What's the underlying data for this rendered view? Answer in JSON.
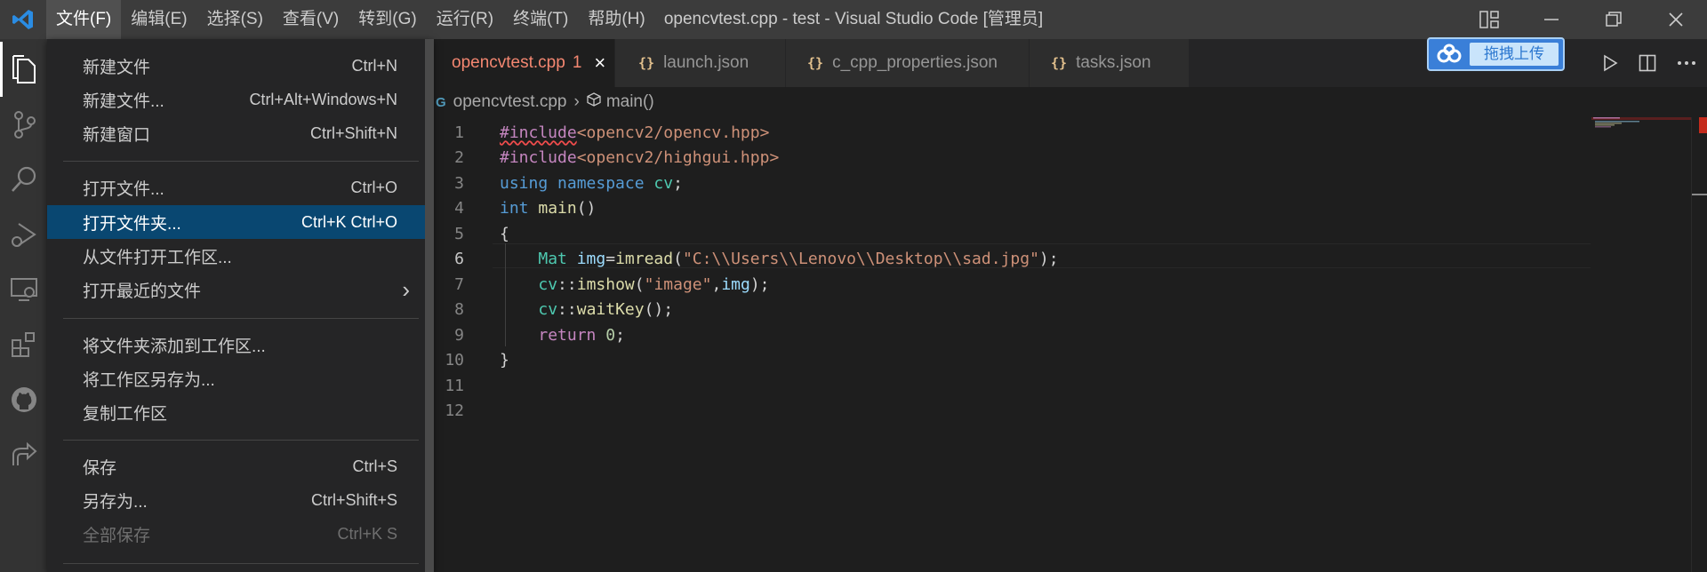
{
  "window": {
    "title": "opencvtest.cpp - test - Visual Studio Code [管理员]"
  },
  "menubar": {
    "items": [
      "文件(F)",
      "编辑(E)",
      "选择(S)",
      "查看(V)",
      "转到(G)",
      "运行(R)",
      "终端(T)",
      "帮助(H)"
    ]
  },
  "file_menu": {
    "items": [
      {
        "label": "新建文件",
        "accel": "Ctrl+N"
      },
      {
        "label": "新建文件...",
        "accel": "Ctrl+Alt+Windows+N"
      },
      {
        "label": "新建窗口",
        "accel": "Ctrl+Shift+N"
      },
      {
        "label": "打开文件...",
        "accel": "Ctrl+O"
      },
      {
        "label": "打开文件夹...",
        "accel": "Ctrl+K Ctrl+O"
      },
      {
        "label": "从文件打开工作区...",
        "accel": ""
      },
      {
        "label": "打开最近的文件",
        "accel": "›"
      },
      {
        "label": "将文件夹添加到工作区...",
        "accel": ""
      },
      {
        "label": "将工作区另存为...",
        "accel": ""
      },
      {
        "label": "复制工作区",
        "accel": ""
      },
      {
        "label": "保存",
        "accel": "Ctrl+S"
      },
      {
        "label": "另存为...",
        "accel": "Ctrl+Shift+S"
      },
      {
        "label": "全部保存",
        "accel": "Ctrl+K S"
      }
    ]
  },
  "tabs": [
    {
      "label": "opencvtest.cpp",
      "badge": "1",
      "close": "×"
    },
    {
      "label": "launch.json",
      "icon": "{}"
    },
    {
      "label": "c_cpp_properties.json",
      "icon": "{}"
    },
    {
      "label": "tasks.json",
      "icon": "{}"
    }
  ],
  "upload_button": {
    "label": "拖拽上传"
  },
  "breadcrumb": {
    "file": "opencvtest.cpp",
    "symbol": "main()"
  },
  "editor": {
    "line_numbers": [
      "1",
      "2",
      "3",
      "4",
      "5",
      "6",
      "7",
      "8",
      "9",
      "10",
      "11",
      "12"
    ],
    "lines": {
      "l1": {
        "a": "#include",
        "b": "<opencv2/opencv.hpp>"
      },
      "l2": {
        "a": "#include",
        "b": "<opencv2/highgui.hpp>"
      },
      "l3": {
        "a": "using",
        "b": " namespace",
        "c": " cv",
        "d": ";"
      },
      "l4": {
        "a": "int",
        "b": " main",
        "c": "()"
      },
      "l5": {
        "a": "{"
      },
      "l6": {
        "a": "Mat",
        "b": " img",
        "c": "=",
        "d": "imread",
        "e": "(",
        "f": "\"C:\\\\Users\\\\Lenovo\\\\Desktop\\\\sad.jpg\"",
        "g": ");"
      },
      "l7": {
        "a": "cv",
        "b": "::",
        "c": "imshow",
        "d": "(",
        "e": "\"image\"",
        "f": ",",
        "g": "img",
        "h": ");"
      },
      "l8": {
        "a": "cv",
        "b": "::",
        "c": "waitKey",
        "d": "();"
      },
      "l9": {
        "a": "return",
        "b": " 0",
        "c": ";"
      },
      "l10": {
        "a": "}"
      }
    }
  },
  "colors": {
    "accent": "#094771",
    "tab_active_text": "#f48771",
    "upload_button": "#3a7fd8"
  }
}
